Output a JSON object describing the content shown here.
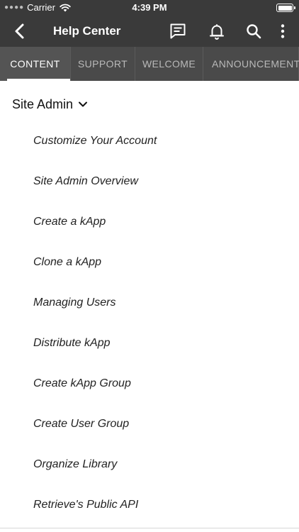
{
  "status_bar": {
    "carrier": "Carrier",
    "time": "4:39 PM",
    "icons": [
      "signal-dots-icon",
      "wifi-icon",
      "battery-icon"
    ]
  },
  "nav": {
    "title": "Help Center",
    "icons": [
      "back-chevron-icon",
      "message-icon",
      "bell-icon",
      "search-icon",
      "more-vertical-icon"
    ]
  },
  "tabs": [
    {
      "label": "CONTENT",
      "active": true
    },
    {
      "label": "SUPPORT",
      "active": false
    },
    {
      "label": "WELCOME",
      "active": false
    },
    {
      "label": "ANNOUNCEMENTS",
      "active": false
    }
  ],
  "section": {
    "title": "Site Admin",
    "icon": "chevron-down-icon"
  },
  "items": [
    "Customize Your Account",
    "Site Admin Overview",
    "Create a kApp",
    "Clone a kApp",
    "Managing Users",
    "Distribute kApp",
    "Create kApp Group",
    "Create User Group",
    "Organize Library",
    "Retrieve's Public API"
  ],
  "colors": {
    "header_bg": "#3a3a3a",
    "tab_bar_bg": "#4a4a4a",
    "active_tab_indicator": "#ffffff"
  }
}
